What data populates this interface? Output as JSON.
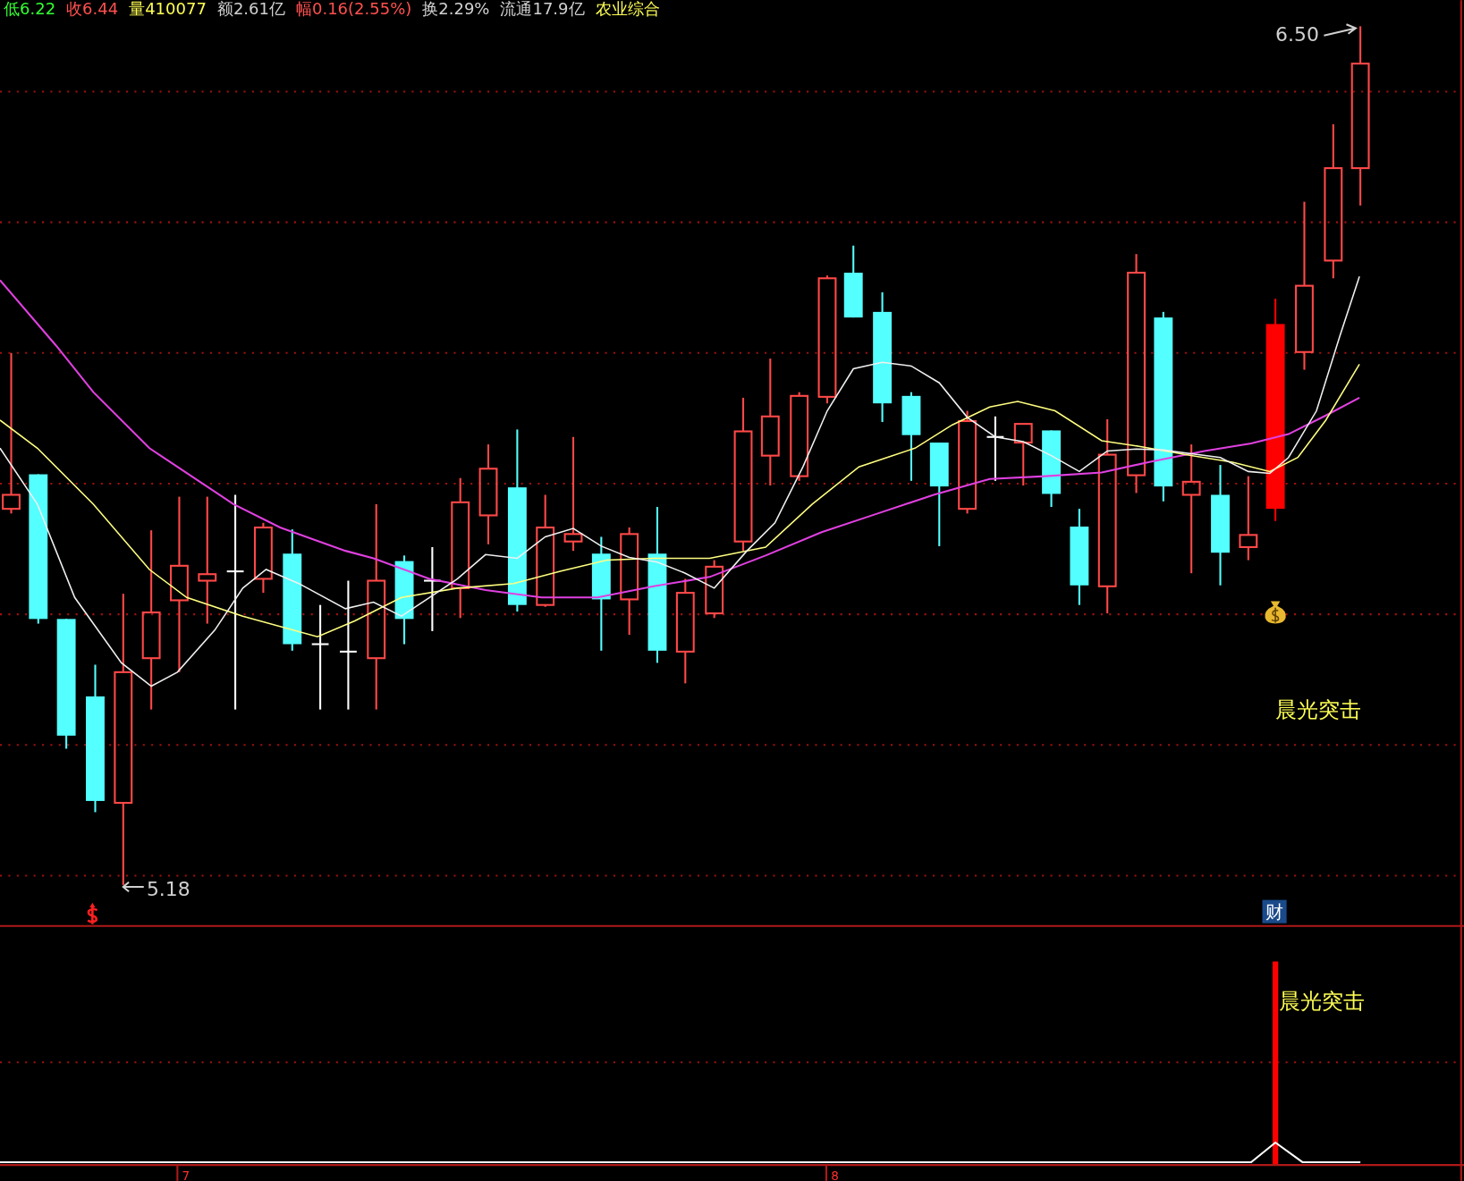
{
  "quote_bar": {
    "items": [
      {
        "text": "低6.22",
        "color": "#33ff33"
      },
      {
        "text": "收6.44",
        "color": "#ff5050"
      },
      {
        "text": "量410077",
        "color": "#ffff54"
      },
      {
        "text": "额2.61亿",
        "color": "#d0d0d0"
      },
      {
        "text": "幅0.16(2.55%)",
        "color": "#ff5050"
      },
      {
        "text": "换2.29%",
        "color": "#d0d0d0"
      },
      {
        "text": "流通17.9亿",
        "color": "#d0d0d0"
      },
      {
        "text": "农业综合",
        "color": "#ffff54"
      }
    ]
  },
  "price_chart": {
    "high_label": "6.50",
    "low_label": "5.18",
    "signal_label": "晨光突击",
    "finance_badge": "财"
  },
  "indicator_panel": {
    "signal_label": "晨光突击"
  },
  "time_axis": {
    "labels": [
      "7",
      "8"
    ]
  }
}
